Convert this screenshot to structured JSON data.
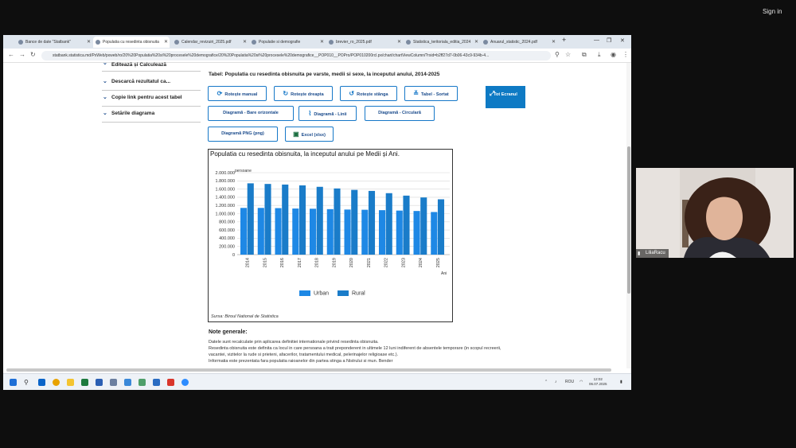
{
  "meeting": {
    "sign_in": "Sign in",
    "participant_name": "LiliaRacu"
  },
  "browser": {
    "tabs": [
      {
        "label": "Bance de date \"Statbank\"",
        "active": false
      },
      {
        "label": "Populatia cu resedinta obisnuita",
        "active": true
      },
      {
        "label": "Calendar_revizuiri_2025.pdf",
        "active": false
      },
      {
        "label": "Populatie si demografie",
        "active": false
      },
      {
        "label": "brevier_ro_2025.pdf",
        "active": false
      },
      {
        "label": "Statistica_teritoriala_editia_2024",
        "active": false
      },
      {
        "label": "Anuarul_statistic_2024.pdf",
        "active": false
      }
    ],
    "url": "statbank.statistica.md/PxWeb/pxweb/ro/20%20Populatia%20si%20procesele%20demografice/20%20Populatia%20si%20procesele%20demografice__POP010__POPro/POP010200rcl.px/chart/chartViewColumn/?rxid=b2ff27d7-0b06-43c9-934b-4..."
  },
  "sidebar": {
    "items": [
      "Editează și Calculează",
      "Descarcă rezultatul ca...",
      "Copie link pentru acest tabel",
      "Setările diagrama"
    ]
  },
  "main": {
    "table_title": "Tabel: Populatia cu resedinta obisnuita pe varste, medii si sexe, la inceputul anului, 2014-2025",
    "buttons": {
      "pivot_manual": "Rotește manual",
      "pivot_right": "Rotește dreapta",
      "pivot_left": "Rotește stânga",
      "table_sort": "Tabel - Sortat",
      "full_screen": "Tot Ecranul",
      "chart_bar_h": "Diagramă - Bare orizontale",
      "chart_line": "Diagramă - Linii",
      "chart_pie": "Diagramă - Circulară",
      "chart_png": "Diagramă PNG (png)",
      "excel": "Excel (xlsx)"
    },
    "notes_title": "Note generale:",
    "notes": [
      "Datele sunt recalculate prin aplicarea definitiei internationale privind resedinta obisnuita.",
      "Resedinta obisnuita este definita ca locul in care persoana a trait preponderent in ultimele 12 luni indiferent de absentele temporare (in scopul recreerii,",
      "vacantei, vizitelor la rude si prieteni, afacerilor, tratamentului medical, pelerinajelor religioase etc.).",
      "Informatia este prezentata fara populatia raioanelor din partea stinga a Nistrului si mun. Bender"
    ]
  },
  "chart_data": {
    "type": "bar",
    "title": "Populatia cu resedinta obisnuita, la inceputul anului pe Medii și Ani.",
    "ylabel": "persoane",
    "xlabel": "Ani",
    "ylim": [
      0,
      2000000
    ],
    "y_ticks": [
      "2.000.000",
      "1.800.000",
      "1.600.000",
      "1.400.000",
      "1.200.000",
      "1.000.000",
      "800.000",
      "600.000",
      "400.000",
      "200.000",
      "0"
    ],
    "categories": [
      "2014",
      "2015",
      "2016",
      "2017",
      "2018",
      "2019",
      "2020",
      "2021",
      "2022",
      "2023",
      "2024",
      "2025"
    ],
    "series": [
      {
        "name": "Urban",
        "color": "#1e88e5",
        "values": [
          1140000,
          1140000,
          1135000,
          1125000,
          1120000,
          1110000,
          1100000,
          1095000,
          1085000,
          1075000,
          1065000,
          1040000
        ]
      },
      {
        "name": "Rural",
        "color": "#1a7cc9",
        "values": [
          1740000,
          1725000,
          1710000,
          1690000,
          1655000,
          1615000,
          1580000,
          1555000,
          1500000,
          1440000,
          1395000,
          1350000
        ]
      }
    ],
    "grid": true,
    "legend_position": "bottom",
    "source": "Sursa: Biroul National de Statistica"
  },
  "taskbar": {
    "language": "ROU",
    "time": "12:02",
    "date": "06.07.2025"
  },
  "colors": {
    "accent": "#0e7ac4",
    "button_border": "#1678c8"
  }
}
